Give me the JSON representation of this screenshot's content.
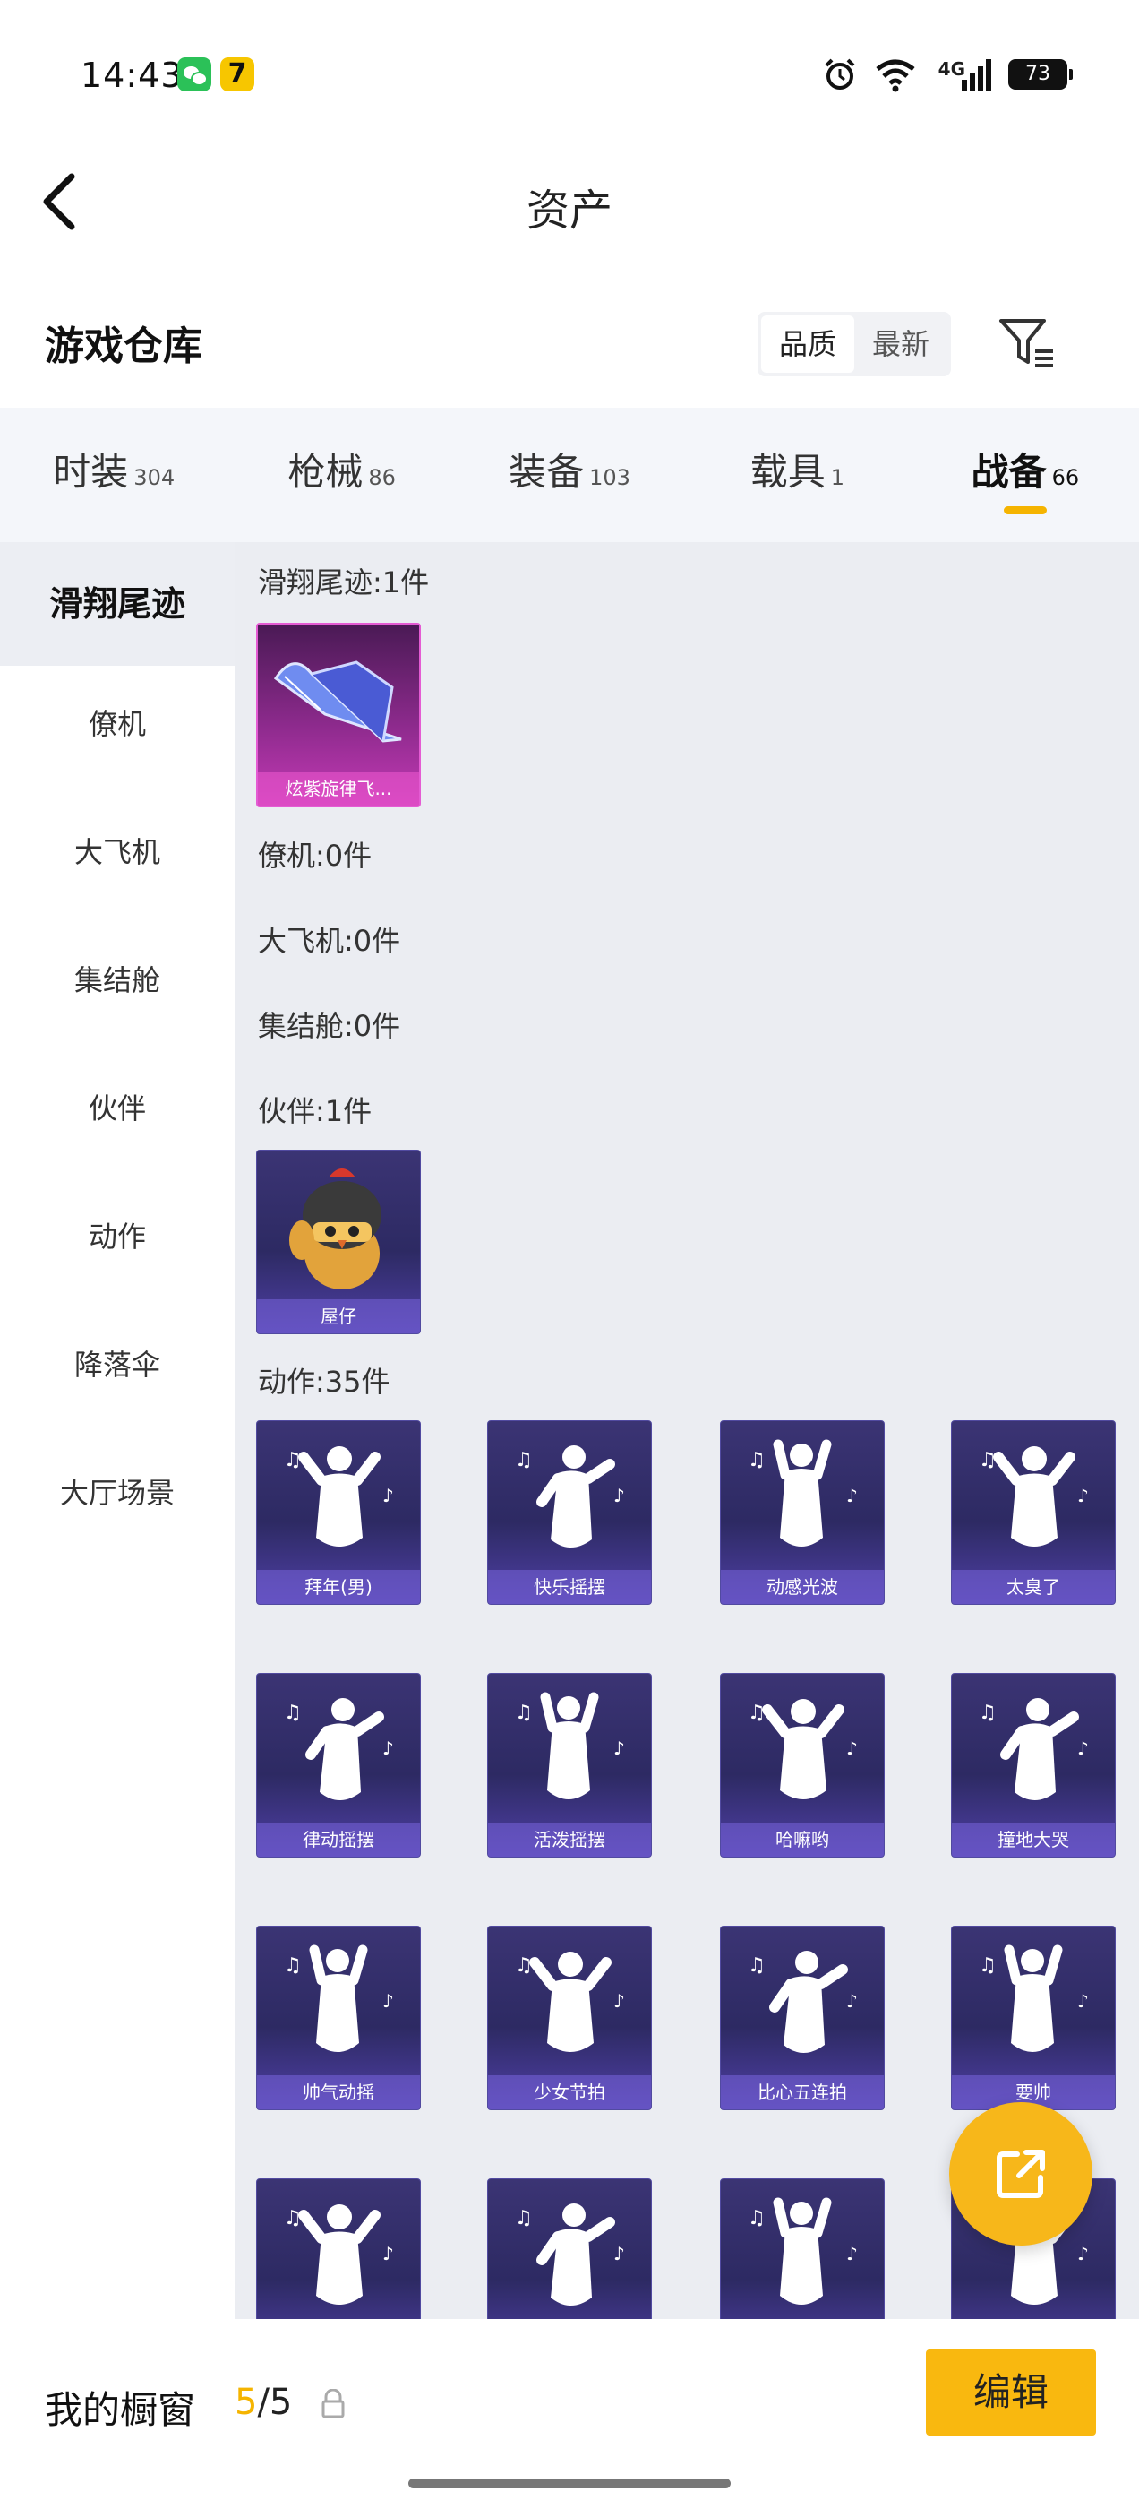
{
  "status_bar": {
    "time": "14:43",
    "network": "4G",
    "battery": "73",
    "icons": [
      "wechat-icon",
      "app-7-icon",
      "alarm-icon",
      "wifi-icon",
      "signal-icon",
      "battery-icon"
    ]
  },
  "header": {
    "title": "资产"
  },
  "warehouse": {
    "title": "游戏仓库",
    "sort_options": [
      "品质",
      "最新"
    ],
    "active_sort": "品质"
  },
  "tabs": [
    {
      "label": "时装",
      "count": "304"
    },
    {
      "label": "枪械",
      "count": "86"
    },
    {
      "label": "装备",
      "count": "103"
    },
    {
      "label": "载具",
      "count": "1"
    },
    {
      "label": "战备",
      "count": "66",
      "active": true
    }
  ],
  "sidebar": {
    "items": [
      "滑翔尾迹",
      "僚机",
      "大飞机",
      "集结舱",
      "伙伴",
      "动作",
      "降落伞",
      "大厅场景"
    ],
    "active": "滑翔尾迹"
  },
  "sections": {
    "glide": {
      "title": "滑翔尾迹:1件",
      "items": [
        "炫紫旋律飞..."
      ]
    },
    "wingman": {
      "title": "僚机:0件"
    },
    "big_plane": {
      "title": "大飞机:0件"
    },
    "pod": {
      "title": "集结舱:0件"
    },
    "partner": {
      "title": "伙伴:1件",
      "items": [
        "屋仔"
      ]
    },
    "emote": {
      "title": "动作:35件",
      "items": [
        "拜年(男)",
        "快乐摇摆",
        "动感光波",
        "太臭了",
        "律动摇摆",
        "活泼摇摆",
        "哈嘛哟",
        "撞地大哭",
        "帅气动摇",
        "少女节拍",
        "比心五连拍",
        "要帅",
        "",
        "",
        "",
        ""
      ]
    }
  },
  "bottom": {
    "window_label": "我的橱窗",
    "count_current": "5",
    "count_total": "/5",
    "edit_label": "编辑"
  },
  "colors": {
    "accent": "#f5b400",
    "card_purple": "#3b3474",
    "card_pink": "#c43ab5"
  }
}
